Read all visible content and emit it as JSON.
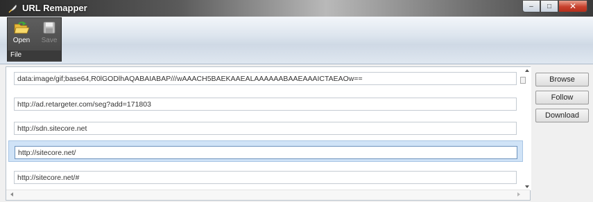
{
  "window": {
    "title": "URL Remapper",
    "controls": {
      "minimize": "–",
      "maximize": "□",
      "close": "✕"
    }
  },
  "ribbon": {
    "group_label": "File",
    "open_label": "Open",
    "save_label": "Save",
    "open_icon": "open-folder-icon",
    "save_icon": "floppy-disk-icon",
    "save_enabled": false
  },
  "urls": [
    "data:image/gif;base64,R0lGODlhAQABAIABAP///wAAACH5BAEKAAEALAAAAAABAAEAAAICTAEAOw==",
    "http://ad.retargeter.com/seg?add=171803",
    "http://sdn.sitecore.net",
    "http://sitecore.net/",
    "http://sitecore.net/#"
  ],
  "selected_index": 3,
  "buttons": {
    "browse": "Browse",
    "follow": "Follow",
    "download": "Download"
  },
  "colors": {
    "selection": "#d0e3f7",
    "close_button": "#c7412d"
  }
}
